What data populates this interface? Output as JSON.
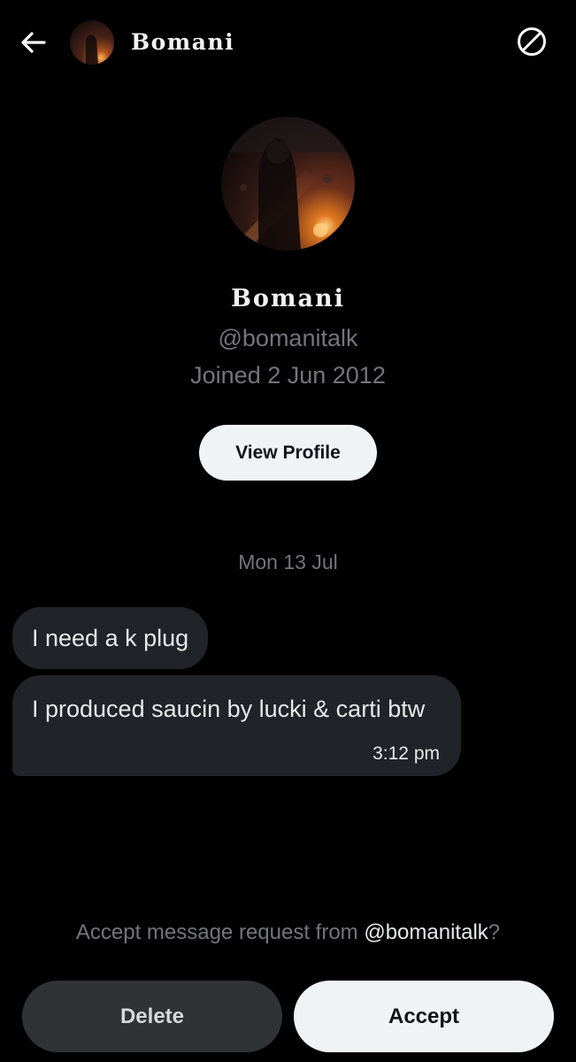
{
  "header": {
    "back_icon": "arrow-left-icon",
    "display_name": "Bomani",
    "block_icon": "block-icon"
  },
  "profile": {
    "display_name": "Bomani",
    "handle": "@bomanitalk",
    "joined": "Joined 2 Jun 2012",
    "view_profile_label": "View Profile"
  },
  "conversation": {
    "date_label": "Mon 13 Jul",
    "messages": [
      {
        "text": "I need a k plug"
      },
      {
        "text": "I produced saucin by lucki & carti btw",
        "time": "3:12 pm"
      }
    ]
  },
  "request": {
    "prompt_prefix": "Accept message request from ",
    "prompt_handle": "@bomanitalk",
    "prompt_suffix": "?",
    "delete_label": "Delete",
    "accept_label": "Accept"
  },
  "colors": {
    "background": "#000000",
    "bubble": "#202327",
    "muted_text": "#71767b",
    "light_button": "#eff3f4",
    "dark_button": "#2f3336"
  }
}
